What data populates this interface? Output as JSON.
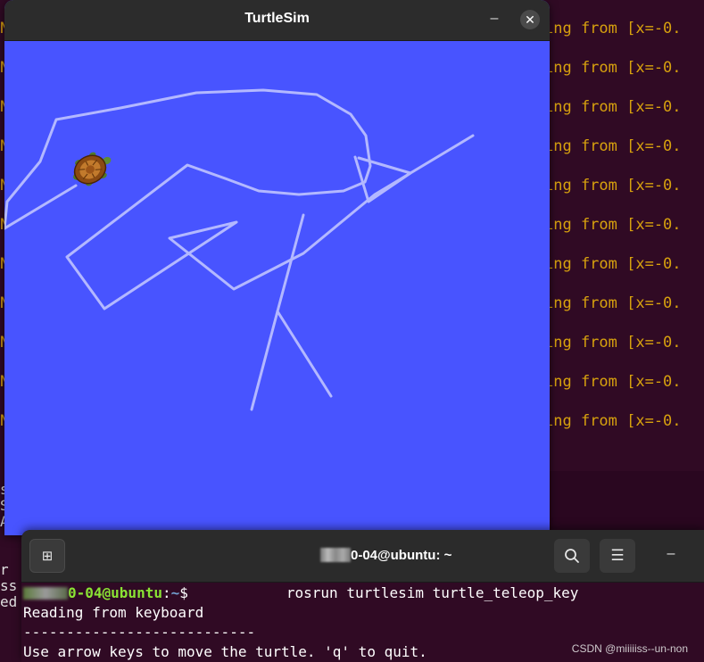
{
  "bg_terminal": {
    "repeated_line": "ing from [x=-0.",
    "line_count": 11,
    "left_chars": [
      "N",
      "N",
      "N",
      "N",
      "N",
      "N",
      "N",
      "N",
      "N",
      "N",
      "N"
    ],
    "below_chars": [
      "s",
      "S",
      "A",
      "",
      "",
      "r",
      "ss",
      "ed"
    ]
  },
  "turtlesim": {
    "title": "TurtleSim",
    "minimize_symbol": "–",
    "close_symbol": "✕",
    "background_color": "#4854ff",
    "path_color": "#b3b8ff"
  },
  "terminal": {
    "new_tab_icon": "⊞",
    "title_suffix": "0-04@ubuntu: ~",
    "search_icon": "⌕",
    "menu_icon": "☰",
    "minimize_symbol": "–",
    "prompt_user": "0-04@ubuntu",
    "prompt_sep": ":",
    "prompt_path": "~",
    "prompt_dollar": "$",
    "command": "rosrun turtlesim turtle_teleop_key",
    "line1": "Reading from keyboard",
    "line2": "---------------------------",
    "line3": "Use arrow keys to move the turtle. 'q' to quit."
  },
  "watermark": "CSDN @miiiiiss--un-non"
}
